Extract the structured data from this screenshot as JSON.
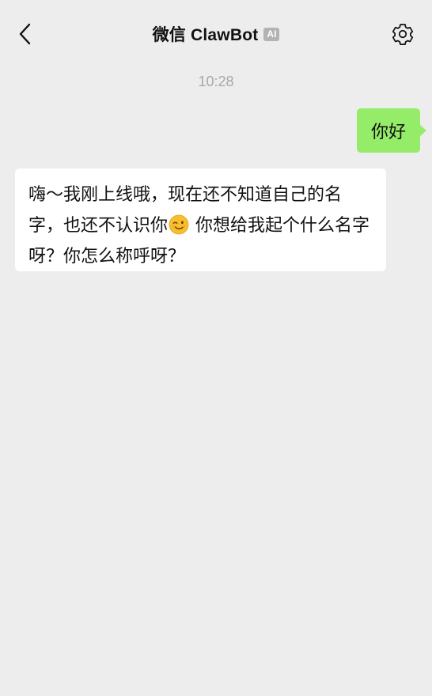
{
  "header": {
    "title": "微信 ClawBot",
    "badge": "AI",
    "back_icon": "chevron-left-icon",
    "settings_icon": "gear-icon"
  },
  "chat": {
    "timestamp": "10:28",
    "messages": [
      {
        "direction": "sent",
        "text": "你好"
      },
      {
        "direction": "received",
        "text_before_emoji": "嗨～我刚上线哦，现在还不知道自己的名字，也还不认识你",
        "emoji": "winking-face",
        "text_after_emoji": " 你想给我起个什么名字呀？你怎么称呼呀？"
      }
    ]
  },
  "colors": {
    "background": "#ededed",
    "sent_bubble": "#95ec69",
    "received_bubble": "#ffffff",
    "timestamp": "#a8a8a8",
    "badge": "#b3b3b3"
  }
}
